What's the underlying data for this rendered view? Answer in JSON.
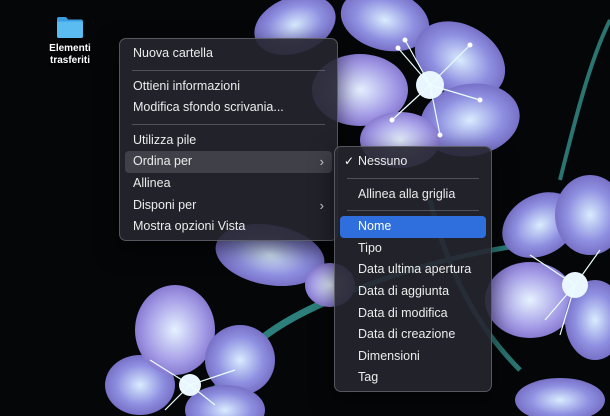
{
  "desktop": {
    "folder_label": "Elementi trasferiti",
    "folder_color": "#4fb6f0"
  },
  "context_menu": {
    "items": [
      {
        "label": "Nuova cartella"
      },
      {
        "label": "Ottieni informazioni"
      },
      {
        "label": "Modifica sfondo scrivania..."
      },
      {
        "label": "Utilizza pile"
      },
      {
        "label": "Ordina per",
        "has_submenu": true,
        "state": "open"
      },
      {
        "label": "Allinea"
      },
      {
        "label": "Disponi per",
        "has_submenu": true
      },
      {
        "label": "Mostra opzioni Vista"
      }
    ]
  },
  "submenu": {
    "items": [
      {
        "label": "Nessuno",
        "checked": true
      },
      {
        "label": "Allinea alla griglia"
      },
      {
        "label": "Nome",
        "state": "highlighted"
      },
      {
        "label": "Tipo"
      },
      {
        "label": "Data ultima apertura"
      },
      {
        "label": "Data di aggiunta"
      },
      {
        "label": "Data di modifica"
      },
      {
        "label": "Data di creazione"
      },
      {
        "label": "Dimensioni"
      },
      {
        "label": "Tag"
      }
    ]
  },
  "icons": {
    "checkmark": "✓",
    "chevron": "›"
  },
  "colors": {
    "highlight": "#2f6fdd",
    "menu_bg": "#262630",
    "wallpaper_bg": "#050608"
  }
}
